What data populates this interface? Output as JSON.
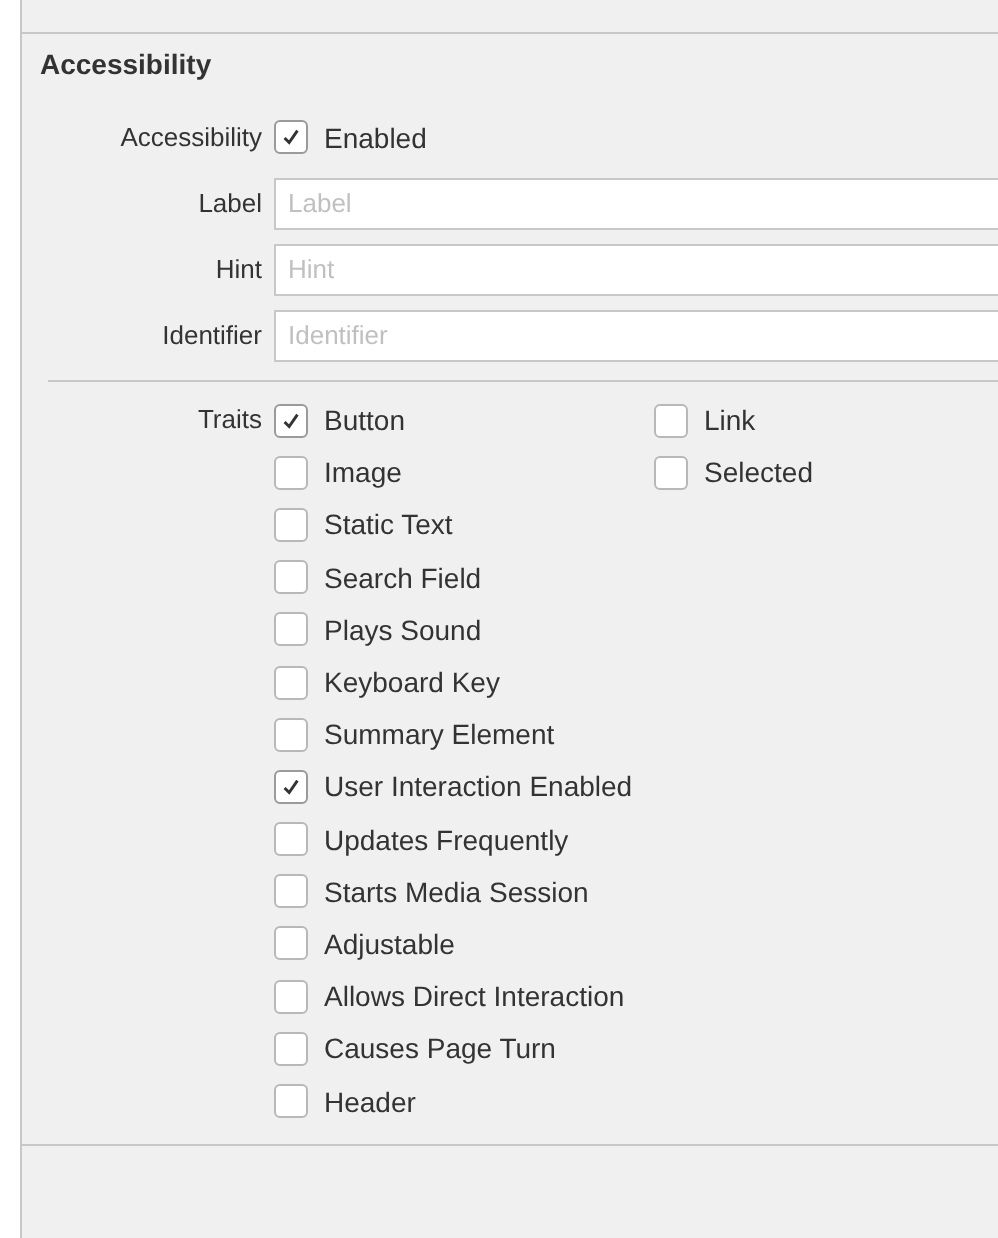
{
  "section": {
    "title": "Accessibility"
  },
  "accessibility": {
    "label": "Accessibility",
    "option": "Enabled",
    "checked": true
  },
  "fields": [
    {
      "label": "Label",
      "placeholder": "Label"
    },
    {
      "label": "Hint",
      "placeholder": "Hint"
    },
    {
      "label": "Identifier",
      "placeholder": "Identifier"
    }
  ],
  "traits": {
    "label": "Traits",
    "column_1": [
      {
        "label": "Button",
        "checked": true
      },
      {
        "label": "Image",
        "checked": false
      },
      {
        "label": "Static Text",
        "checked": false
      },
      {
        "label": "Search Field",
        "checked": false
      },
      {
        "label": "Plays Sound",
        "checked": false
      },
      {
        "label": "Keyboard Key",
        "checked": false
      },
      {
        "label": "Summary Element",
        "checked": false
      },
      {
        "label": "User Interaction Enabled",
        "checked": true
      },
      {
        "label": "Updates Frequently",
        "checked": false
      },
      {
        "label": "Starts Media Session",
        "checked": false
      },
      {
        "label": "Adjustable",
        "checked": false
      },
      {
        "label": "Allows Direct Interaction",
        "checked": false
      },
      {
        "label": "Causes Page Turn",
        "checked": false
      },
      {
        "label": "Header",
        "checked": false
      }
    ],
    "column_2": [
      {
        "label": "Link",
        "checked": false
      },
      {
        "label": "Selected",
        "checked": false
      }
    ]
  }
}
